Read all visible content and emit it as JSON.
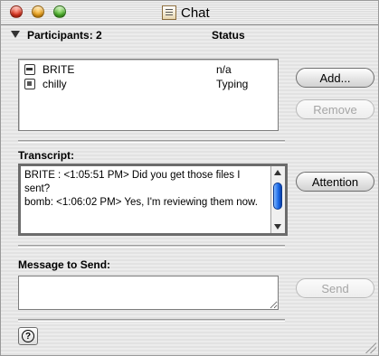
{
  "window": {
    "title": "Chat"
  },
  "participants": {
    "header": "Participants: 2",
    "status_header": "Status",
    "rows": [
      {
        "name": "BRITE",
        "status": "n/a",
        "icon": "network-icon"
      },
      {
        "name": "chilly",
        "status": "Typing",
        "icon": "document-icon"
      }
    ],
    "add_label": "Add...",
    "remove_label": "Remove"
  },
  "transcript": {
    "label": "Transcript:",
    "text": "BRITE : <1:05:51 PM> Did you get those files I sent?\nbomb: <1:06:02 PM> Yes, I'm reviewing them now.",
    "attention_label": "Attention"
  },
  "message": {
    "label": "Message to Send:",
    "value": "",
    "send_label": "Send"
  },
  "colors": {
    "scroll_thumb": "#1a6ae8",
    "close": "#e0341f",
    "minimize": "#f0a31a",
    "zoom": "#4cb52a"
  }
}
